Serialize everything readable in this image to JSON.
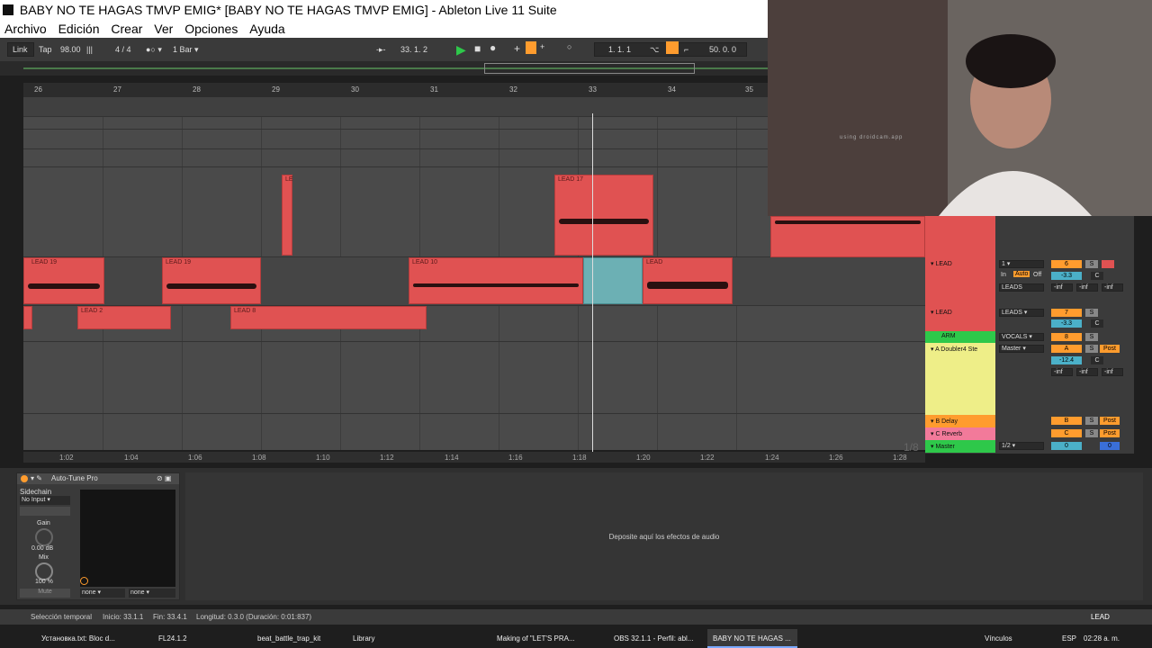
{
  "window": {
    "title": "BABY NO TE HAGAS TMVP EMIG*  [BABY NO TE HAGAS TMVP EMIG] - Ableton Live 11 Suite"
  },
  "menu": [
    "Archivo",
    "Edición",
    "Crear",
    "Ver",
    "Opciones",
    "Ayuda"
  ],
  "transport": {
    "link": "Link",
    "tap": "Tap",
    "tempo": "98.00",
    "signature": "4 / 4",
    "quantize": "1 Bar",
    "position": "33.  1.  2",
    "loop_start": "1.  1.  1",
    "loop_length": "50.  0.  0"
  },
  "ruler": [
    "26",
    "27",
    "28",
    "29",
    "30",
    "31",
    "32",
    "33",
    "34",
    "35"
  ],
  "clips": {
    "c1": "LE",
    "c2": "LEAD 17",
    "c3": "LEAD 19",
    "c4": "LEAD 19",
    "c5": "LEAD 10",
    "c6": "LEAD",
    "c7": "LEAD 2",
    "c8": "LEAD 8"
  },
  "timeline": [
    "1:02",
    "1:04",
    "1:06",
    "1:08",
    "1:10",
    "1:12",
    "1:14",
    "1:16",
    "1:18",
    "1:20",
    "1:22",
    "1:24",
    "1:26",
    "1:28"
  ],
  "timeline_marker": "1/8",
  "mixer": {
    "row1_name": "LEAD",
    "row1_in": "In",
    "row1_auto": "Auto",
    "row1_off": "Off",
    "row1_route": "LEADS",
    "row1_num": "6",
    "row1_vol": "-3.3",
    "row1_pan": "C",
    "row1_inf1": "-inf",
    "row1_inf2": "-inf",
    "row1_inf3": "-inf",
    "row1_input": "1",
    "row2_name": "LEAD",
    "row2_route": "LEADS",
    "row2_num": "7",
    "row2_vol": "-3.3",
    "row2_pan": "C",
    "arm_label": "ARM",
    "vocals_label": "VOCALS",
    "vocals_num": "8",
    "ret_a_name": "A Doubler4 Ste",
    "ret_a_route": "Master",
    "ret_a_letter": "A",
    "ret_a_vol": "-12.4",
    "ret_a_pan": "C",
    "ret_a_post": "Post",
    "ret_a_inf1": "-inf",
    "ret_a_inf2": "-inf",
    "ret_a_inf3": "-inf",
    "ret_b_name": "B Delay",
    "ret_b_letter": "B",
    "ret_b_post": "Post",
    "ret_c_name": "C Reverb",
    "ret_c_letter": "C",
    "ret_c_post": "Post",
    "master_name": "Master",
    "master_route": "1/2",
    "master_num": "0",
    "master_val": "0",
    "s_label": "S",
    "c_label": "C"
  },
  "webcam": {
    "watermark": "using droidcam.app"
  },
  "plugin": {
    "title": "Auto-Tune Pro",
    "sidechain": "Sidechain",
    "sidechain_value": "No Input",
    "gain_label": "Gain",
    "gain_value": "0.00 dB",
    "mix_label": "Mix",
    "mix_value": "100 %",
    "mute": "Mute",
    "sel1": "none",
    "sel2": "none"
  },
  "drop_zone": "Deposite aquí los efectos de audio",
  "status": {
    "selection": "Selección temporal",
    "start": "Inicio: 33.1.1",
    "end": "Fin: 33.4.1",
    "length": "Longitud: 0.3.0 (Duración: 0:01:837)",
    "right": "Vínculos",
    "track": "LEAD"
  },
  "taskbar": {
    "items": [
      "Установка.txt: Bloc d...",
      "FL24.1.2",
      "beat_battle_trap_kit",
      "Library",
      "Making of \"LET'S PRA...",
      "OBS 32.1.1 - Perfil: abl...",
      "BABY NO TE HAGAS ..."
    ],
    "lang": "ESP",
    "time": "02:28 a. m."
  },
  "colors": {
    "clip_red": "#e05252",
    "clip_blue": "#6cb0b4",
    "return_yellow": "#eeee88",
    "accent_orange": "#ff9c2e",
    "master_green": "#2ec84a"
  }
}
